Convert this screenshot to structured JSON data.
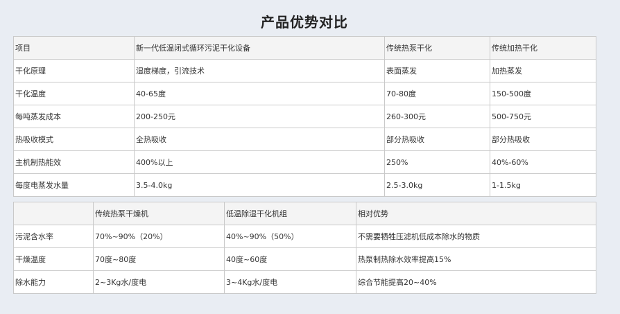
{
  "title": "产品优势对比",
  "table1": {
    "headers": [
      "项目",
      "新一代低温闭式循环污泥干化设备",
      "传统热泵干化",
      "传统加热干化"
    ],
    "rows": [
      [
        "干化原理",
        "湿度梯度，引流技术",
        "表面蒸发",
        "加热蒸发"
      ],
      [
        "干化温度",
        "40-65度",
        "70-80度",
        "150-500度"
      ],
      [
        "每吨蒸发成本",
        "200-250元",
        "260-300元",
        "500-750元"
      ],
      [
        "热吸收模式",
        "全热吸收",
        "部分热吸收",
        "部分热吸收"
      ],
      [
        "主机制热能效",
        "400%以上",
        "250%",
        "40%-60%"
      ],
      [
        "每度电蒸发水量",
        "3.5-4.0kg",
        "2.5-3.0kg",
        "1-1.5kg"
      ]
    ]
  },
  "table2": {
    "headers": [
      "",
      "传统热泵干燥机",
      "低温除湿干化机组",
      "相对优势"
    ],
    "rows": [
      [
        "污泥含水率",
        "70%~90%（20%）",
        "40%~90%（50%）",
        "不需要牺牲压滤机低成本除水的物质"
      ],
      [
        "干燥温度",
        "70度~80度",
        "40度~60度",
        "热泵制热除水效率提高15%"
      ],
      [
        "除水能力",
        "2~3Kg水/度电",
        "3~4Kg水/度电",
        "综合节能提高20~40%"
      ]
    ]
  }
}
